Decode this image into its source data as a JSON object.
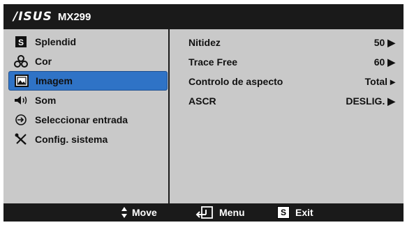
{
  "title": {
    "brand": "/ISUS",
    "model": "MX299"
  },
  "menu": [
    {
      "label": "Splendid",
      "icon": "splendid-s-icon",
      "selected": false
    },
    {
      "label": "Cor",
      "icon": "color-circles-icon",
      "selected": false
    },
    {
      "label": "Imagem",
      "icon": "image-icon",
      "selected": true
    },
    {
      "label": "Som",
      "icon": "speaker-icon",
      "selected": false
    },
    {
      "label": "Seleccionar entrada",
      "icon": "input-select-icon",
      "selected": false
    },
    {
      "label": "Config. sistema",
      "icon": "tools-icon",
      "selected": false
    }
  ],
  "settings": [
    {
      "label": "Nitidez",
      "value": "50 ▶"
    },
    {
      "label": "Trace Free",
      "value": "60 ▶"
    },
    {
      "label": "Controlo de aspecto",
      "value": "Total ▸"
    },
    {
      "label": "ASCR",
      "value": "DESLIG. ▶"
    }
  ],
  "footer": {
    "move": "Move",
    "menu": "Menu",
    "exit": "Exit",
    "exit_key": "S"
  },
  "colors": {
    "selection": "#2f73c6",
    "panel": "#c9c9c9",
    "chrome": "#1a1a1a"
  }
}
